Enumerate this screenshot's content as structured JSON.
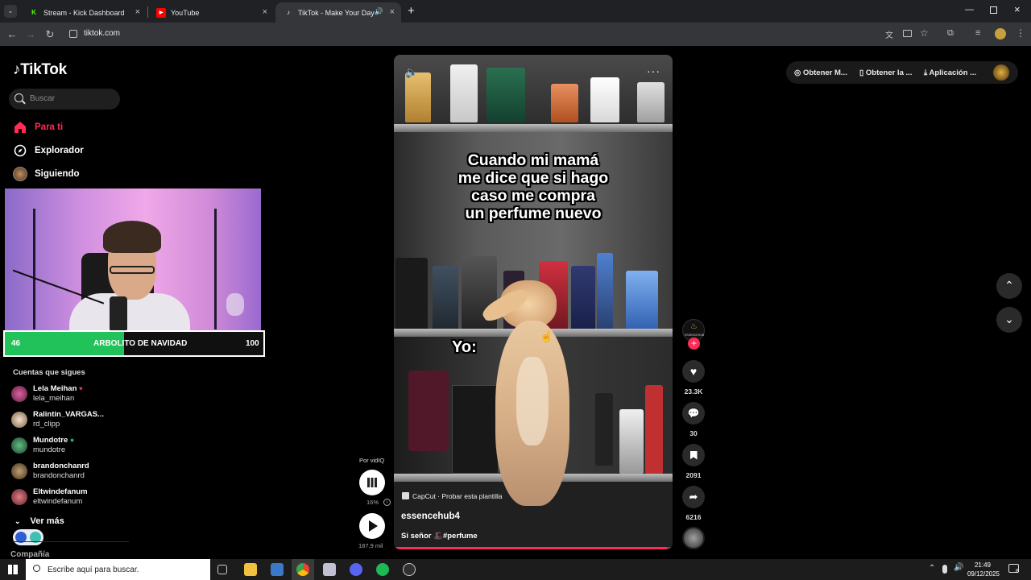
{
  "browser": {
    "tabs": [
      {
        "title": "Stream - Kick Dashboard",
        "favicon_letter": "K",
        "favicon_color": "#53fc18"
      },
      {
        "title": "YouTube",
        "favicon_letter": "▶",
        "favicon_color": "#ff0000"
      },
      {
        "title": "TikTok - Make Your Day",
        "favicon_letter": "♪",
        "favicon_color": "#000000"
      }
    ],
    "url": "tiktok.com"
  },
  "sidebar": {
    "logo": "TikTok",
    "search_placeholder": "Buscar",
    "nav": [
      {
        "label": "Para ti",
        "icon": "home-icon",
        "active": true
      },
      {
        "label": "Explorador",
        "icon": "compass-icon"
      },
      {
        "label": "Siguiendo",
        "icon": "avatar"
      }
    ],
    "overlay_bar": {
      "left": "46",
      "label": "ARBOLITO DE NAVIDAD",
      "right": "100",
      "progress": 0.46
    },
    "following_title": "Cuentas que sigues",
    "accounts": [
      {
        "name": "Lela Meihan",
        "user": "lela_meihan",
        "badge": "♥"
      },
      {
        "name": "Ralintin_VARGAS...",
        "user": "rd_clipp",
        "badge": ""
      },
      {
        "name": "Mundotre",
        "user": "mundotre",
        "badge": "●"
      },
      {
        "name": "brandonchanrd",
        "user": "brandonchanrd",
        "badge": ""
      },
      {
        "name": "Eltwindefanum",
        "user": "eltwindefanum",
        "badge": ""
      }
    ],
    "see_more": "Ver más",
    "company": "Compañía"
  },
  "header_actions": {
    "coins": "Obtener M...",
    "app": "Obtener la ...",
    "desktop": "Aplicación ..."
  },
  "video": {
    "caption_top": [
      "Cuando mi mamá",
      "me dice que si hago",
      "caso me compra",
      "un perfume nuevo"
    ],
    "caption_yo": "Yo:",
    "capcut": "CapCut · Probar esta plantilla",
    "author": "essencehub4",
    "description": "Si señor 🎩#perfume",
    "avatar_label": "ESSENCEHUB"
  },
  "rail": {
    "likes": "23.3K",
    "comments": "30",
    "saves": "2091",
    "shares": "6216"
  },
  "vidiq": {
    "label": "Por vidIQ",
    "percent": "16%",
    "views": "187.9 mil"
  },
  "taskbar": {
    "search_placeholder": "Escribe aquí para buscar.",
    "time": "21:49",
    "date": "09/12/2025",
    "notifications": "8"
  }
}
